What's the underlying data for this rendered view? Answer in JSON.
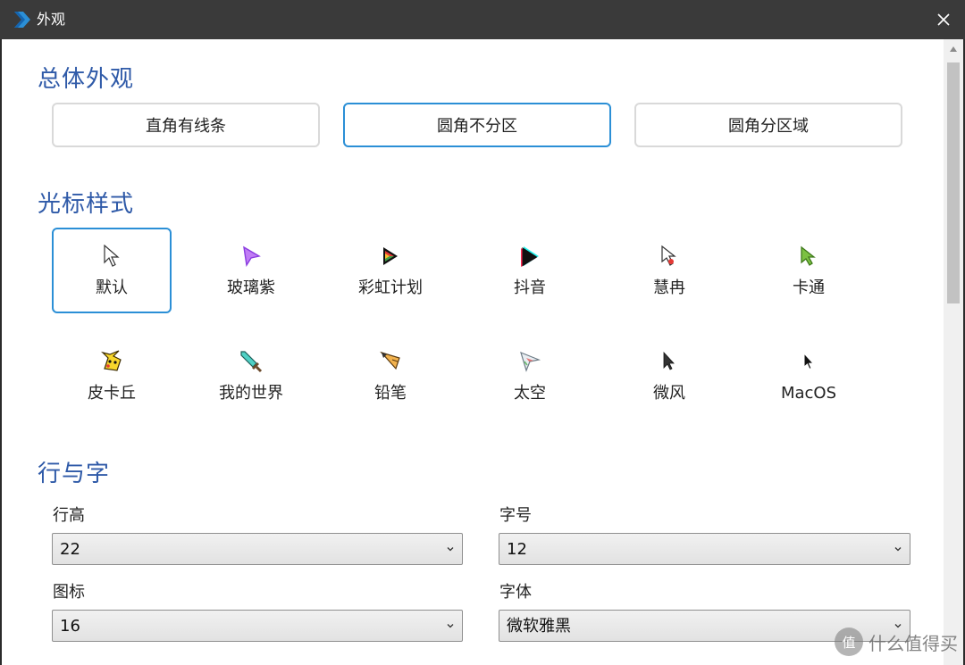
{
  "window": {
    "title": "外观"
  },
  "sections": {
    "appearance": "总体外观",
    "cursor": "光标样式",
    "text": "行与字"
  },
  "appearance_options": [
    {
      "label": "直角有线条",
      "selected": false
    },
    {
      "label": "圆角不分区",
      "selected": true
    },
    {
      "label": "圆角分区域",
      "selected": false
    }
  ],
  "cursor_styles": [
    {
      "label": "默认",
      "icon": "default-arrow-icon",
      "selected": true
    },
    {
      "label": "玻璃紫",
      "icon": "purple-glass-arrow-icon",
      "selected": false
    },
    {
      "label": "彩虹计划",
      "icon": "rainbow-arrow-icon",
      "selected": false
    },
    {
      "label": "抖音",
      "icon": "tiktok-arrow-icon",
      "selected": false
    },
    {
      "label": "慧冉",
      "icon": "white-red-arrow-icon",
      "selected": false
    },
    {
      "label": "卡通",
      "icon": "green-cartoon-arrow-icon",
      "selected": false
    },
    {
      "label": "皮卡丘",
      "icon": "pikachu-icon",
      "selected": false
    },
    {
      "label": "我的世界",
      "icon": "minecraft-sword-icon",
      "selected": false
    },
    {
      "label": "铅笔",
      "icon": "pencil-icon",
      "selected": false
    },
    {
      "label": "太空",
      "icon": "space-arrow-icon",
      "selected": false
    },
    {
      "label": "微风",
      "icon": "breeze-arrow-icon",
      "selected": false
    },
    {
      "label": "MacOS",
      "icon": "macos-arrow-icon",
      "selected": false
    }
  ],
  "fields": {
    "line_height": {
      "label": "行高",
      "value": "22"
    },
    "font_size": {
      "label": "字号",
      "value": "12"
    },
    "icon_size": {
      "label": "图标",
      "value": "16"
    },
    "font_family": {
      "label": "字体",
      "value": "微软雅黑"
    }
  },
  "watermark": {
    "badge": "值",
    "text": "什么值得买"
  },
  "colors": {
    "accent": "#2b8fd6",
    "section_title": "#2f5aa8",
    "titlebar": "#3a3a3a"
  }
}
